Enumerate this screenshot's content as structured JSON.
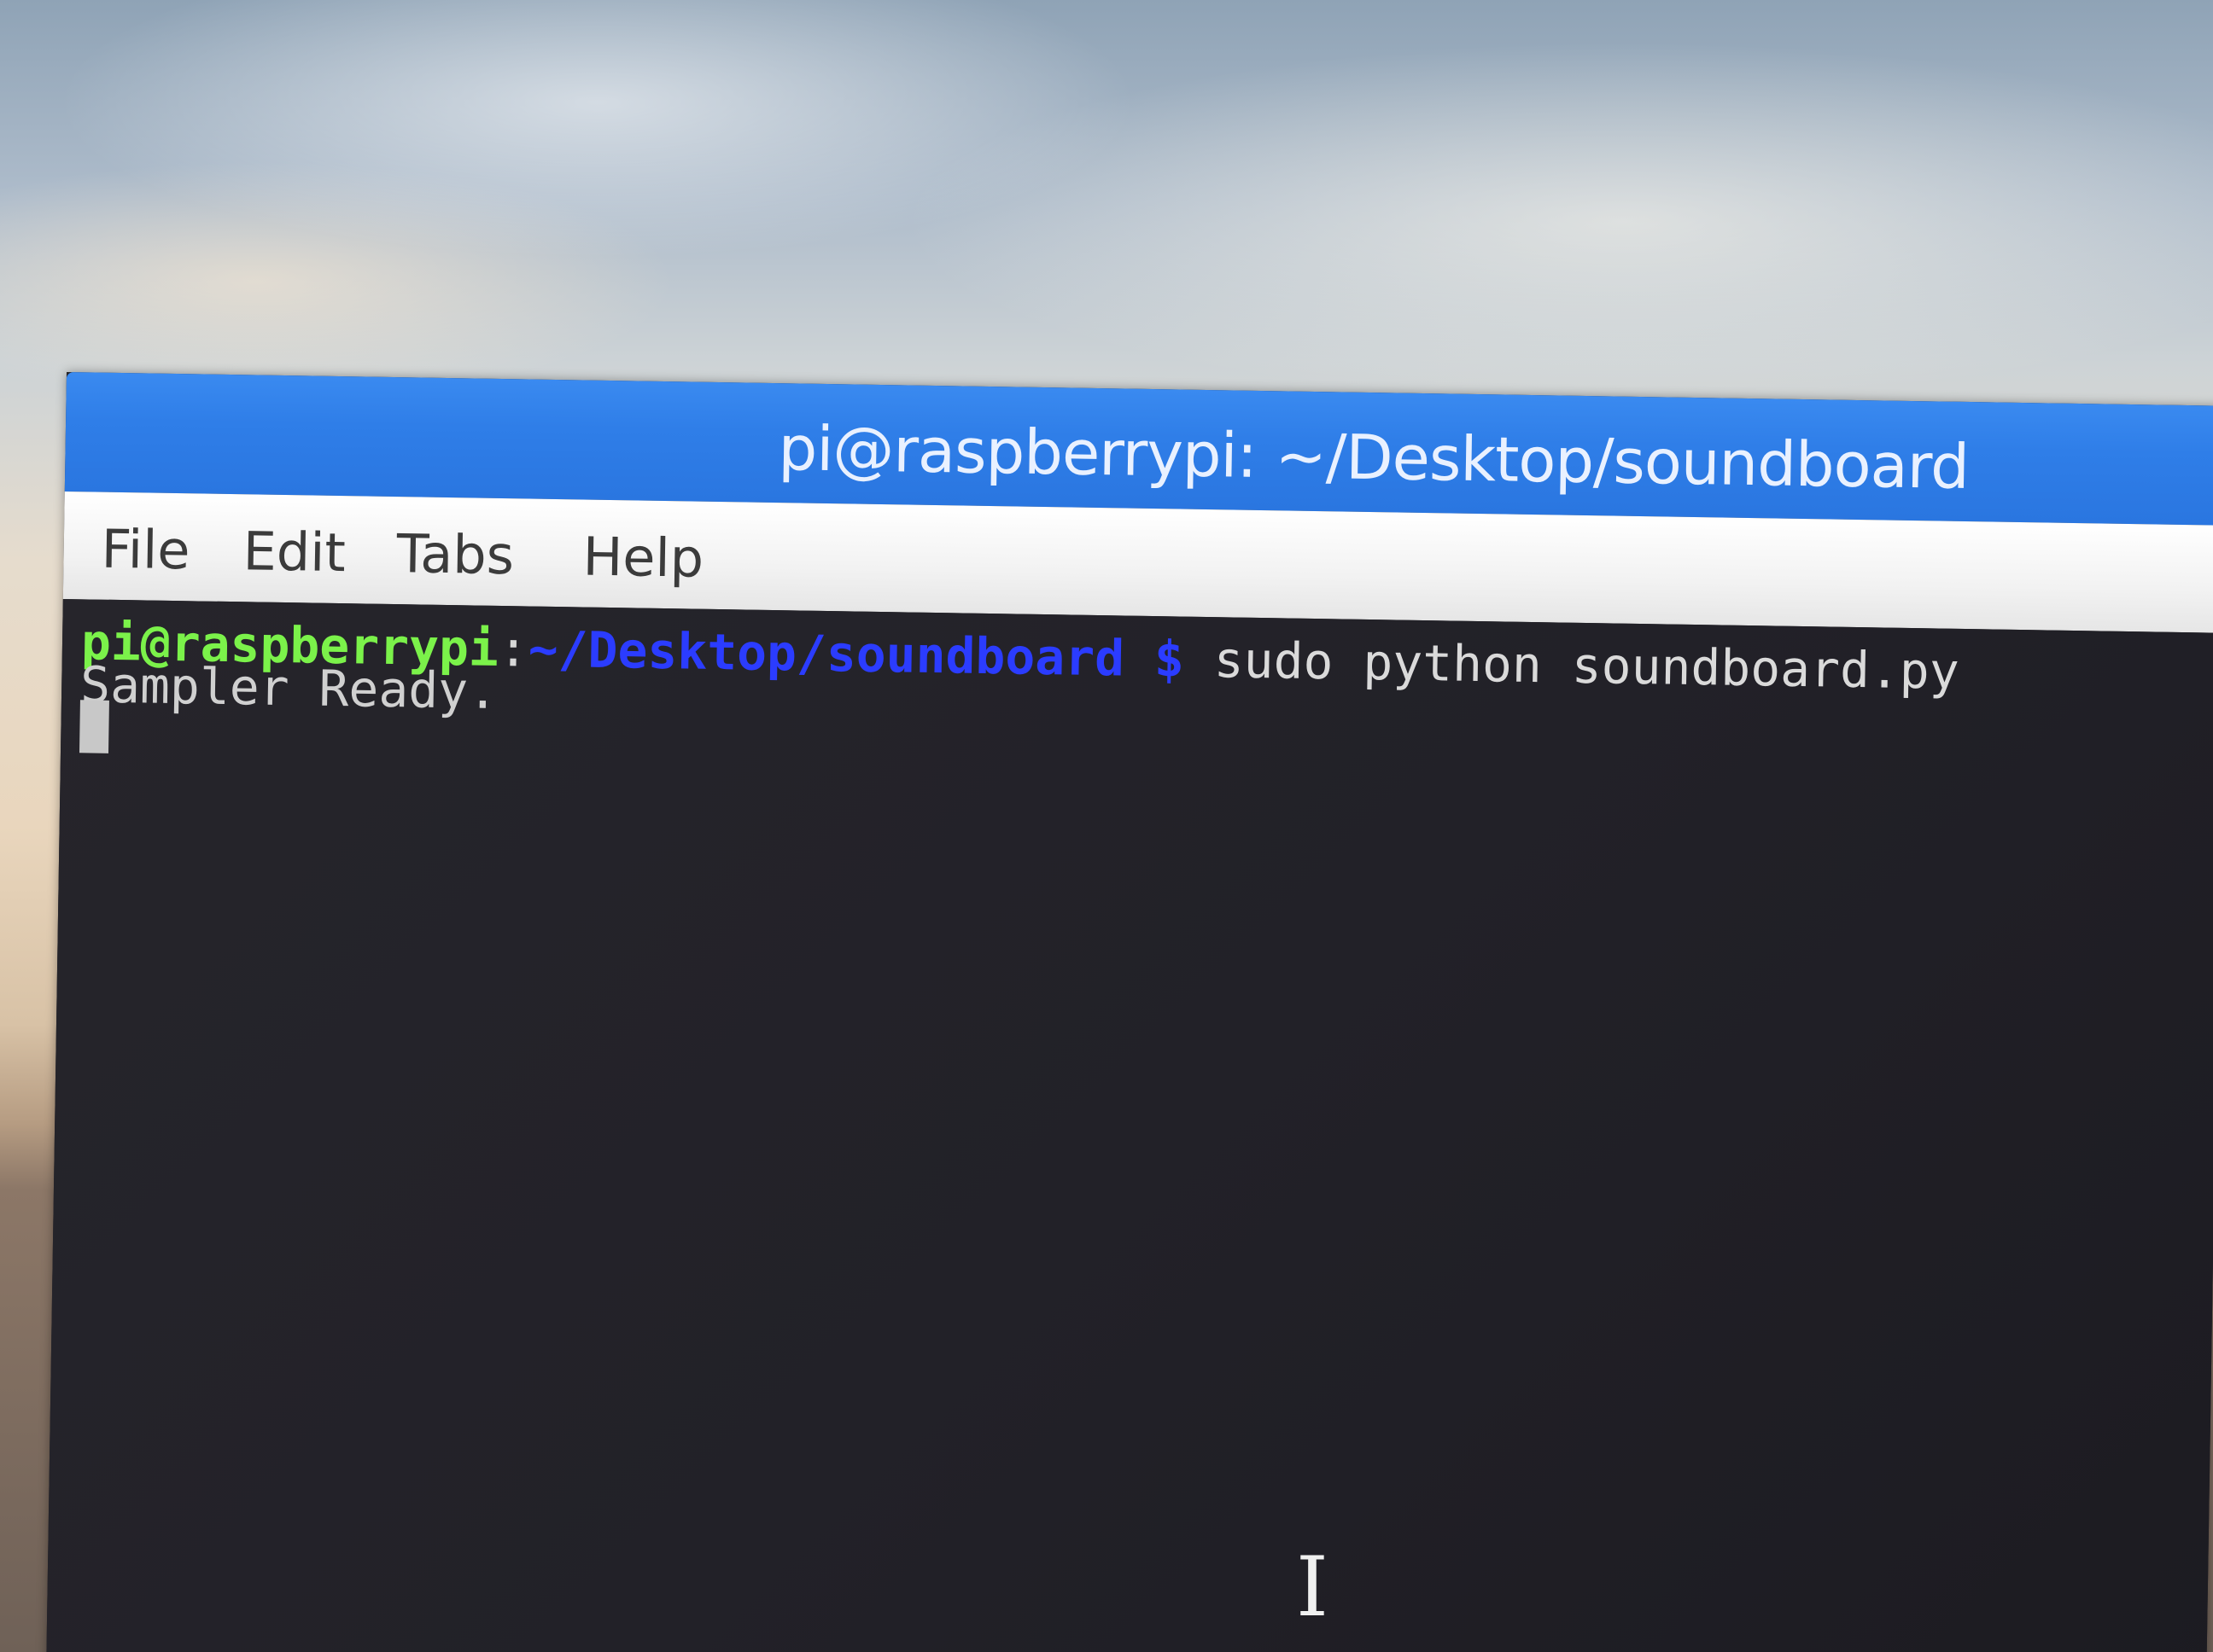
{
  "window": {
    "title": "pi@raspberrypi: ~/Desktop/soundboard"
  },
  "menu": {
    "items": [
      "File",
      "Edit",
      "Tabs",
      "Help"
    ]
  },
  "terminal": {
    "prompt_user": "pi@raspberrypi",
    "prompt_colon": ":",
    "prompt_path": "~/Desktop/soundboard",
    "prompt_dollar": "$",
    "command": "sudo python soundboard.py",
    "output_line": "Sampler Ready."
  },
  "colors": {
    "titlebar": "#2f7ee8",
    "prompt_user": "#7bf24a",
    "prompt_path": "#2b3cff",
    "terminal_bg": "#252429"
  },
  "icons": {
    "mouse_pointer": "text-ibeam-cursor-icon"
  }
}
